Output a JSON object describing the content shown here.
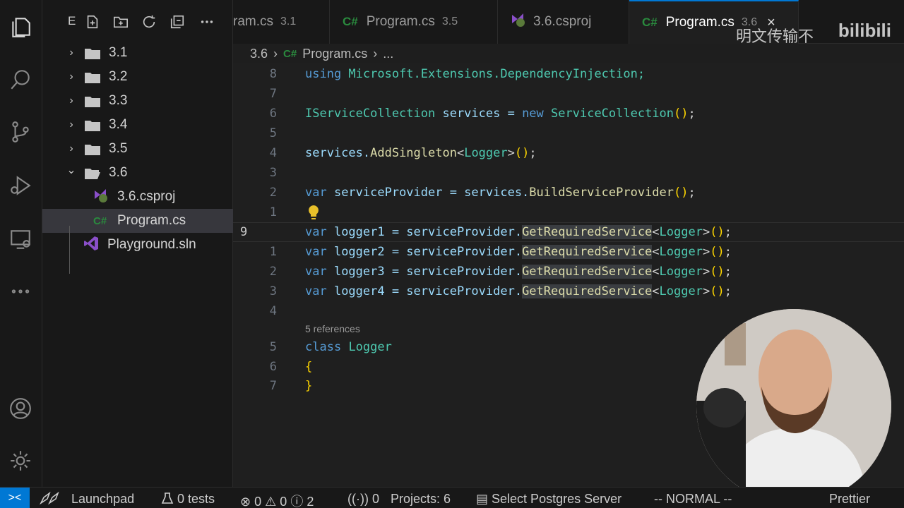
{
  "sidebar": {
    "title": "E",
    "tree": [
      {
        "label": "3.1",
        "kind": "folder",
        "expanded": false
      },
      {
        "label": "3.2",
        "kind": "folder",
        "expanded": false
      },
      {
        "label": "3.3",
        "kind": "folder",
        "expanded": false
      },
      {
        "label": "3.4",
        "kind": "folder",
        "expanded": false
      },
      {
        "label": "3.5",
        "kind": "folder",
        "expanded": false
      },
      {
        "label": "3.6",
        "kind": "folder",
        "expanded": true
      },
      {
        "label": "3.6.csproj",
        "kind": "csproj"
      },
      {
        "label": "Program.cs",
        "kind": "cs",
        "selected": true
      },
      {
        "label": "Playground.sln",
        "kind": "sln"
      }
    ],
    "chevron_right": "›",
    "chevron_down": "⌄",
    "cs_badge": "C#"
  },
  "tabs": [
    {
      "label": "ram.cs",
      "suffix": "3.1"
    },
    {
      "label": "Program.cs",
      "suffix": "3.5",
      "icon": "C#"
    },
    {
      "label": "3.6.csproj",
      "suffix": ""
    },
    {
      "label": "Program.cs",
      "suffix": "3.6",
      "icon": "C#",
      "active": true,
      "close": "×"
    }
  ],
  "watermark": {
    "cn": "明文传输不",
    "brand": "bilibili"
  },
  "breadcrumb": {
    "folder": "3.6",
    "sep": "›",
    "icon": "C#",
    "file": "Program.cs",
    "more": "..."
  },
  "editor": {
    "line_numbers": [
      "8",
      "7",
      "6",
      "5",
      "4",
      "3",
      "2",
      "1",
      "9",
      "1",
      "2",
      "3",
      "4",
      "",
      "5",
      "6",
      "7"
    ],
    "references": "5 references",
    "lines": {
      "l1": [
        "using",
        " Microsoft.Extensions.DependencyInjection;"
      ],
      "l3": [
        "IServiceCollection",
        " services = ",
        "new",
        " ",
        "ServiceCollection",
        "(",
        ")",
        ";"
      ],
      "l5": [
        "services.",
        "AddSingleton",
        "<",
        "Logger",
        ">",
        "(",
        ")",
        ";"
      ],
      "l7": [
        "var",
        " serviceProvider = services.",
        "BuildServiceProvider",
        "(",
        ")",
        ";"
      ],
      "l9": [
        "var",
        " logger1 = serviceProvider.",
        "GetRequiredService",
        "<",
        "Logger",
        ">",
        "(",
        ")",
        ";"
      ],
      "l10": [
        "var",
        " logger2 = serviceProvider.",
        "GetRequiredService",
        "<",
        "Logger",
        ">",
        "(",
        ")",
        ";"
      ],
      "l11": [
        "var",
        " logger3 = serviceProvider.",
        "GetRequiredService",
        "<",
        "Logger",
        ">",
        "(",
        ")",
        ";"
      ],
      "l12": [
        "var",
        " logger4 = serviceProvider.",
        "GetRequiredService",
        "<",
        "Logger",
        ">",
        "(",
        ")",
        ";"
      ],
      "l14": [
        "class",
        " ",
        "Logger"
      ],
      "l15": [
        "{"
      ],
      "l16": [
        "}"
      ]
    }
  },
  "status": {
    "remote": "><",
    "launchpad": "Launchpad",
    "tests": "0 tests",
    "errors": "0",
    "warnings": "0",
    "info": "2",
    "ports": "0",
    "projects": "Projects: 6",
    "postgres": "Select Postgres Server",
    "mode": "-- NORMAL --",
    "prettier": "Prettier"
  }
}
